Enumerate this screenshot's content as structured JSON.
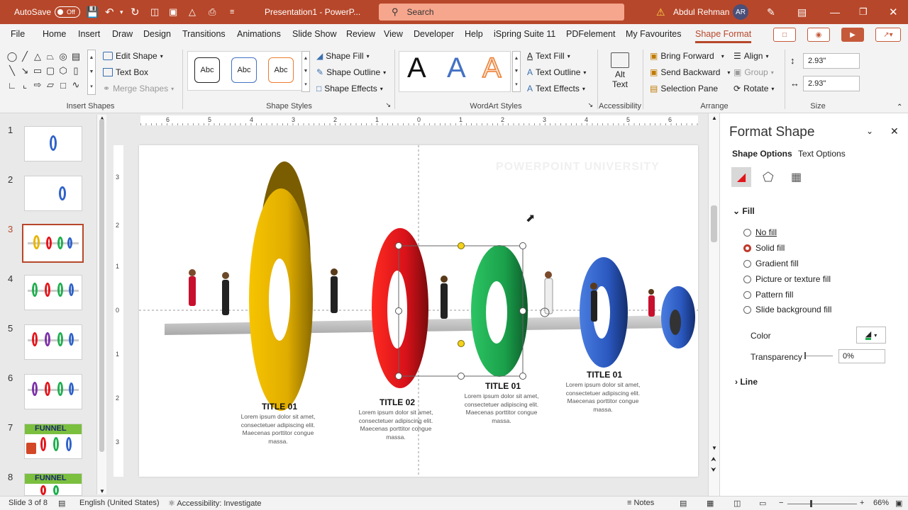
{
  "titlebar": {
    "autosave_label": "AutoSave",
    "autosave_state": "Off",
    "doc_title": "Presentation1 - PowerP...",
    "search_placeholder": "Search",
    "user_name": "Abdul Rehman",
    "user_initials": "AR",
    "accent": "#b7472a"
  },
  "menu": {
    "items": [
      "File",
      "Home",
      "Insert",
      "Draw",
      "Design",
      "Transitions",
      "Animations",
      "Slide Show",
      "Review",
      "View",
      "Developer",
      "Help",
      "iSpring Suite 11",
      "PDFelement",
      "My Favourites",
      "Shape Format"
    ],
    "active": "Shape Format"
  },
  "ribbon": {
    "insert_shapes": {
      "label": "Insert Shapes",
      "edit_shape": "Edit Shape",
      "text_box": "Text Box",
      "merge_shapes": "Merge Shapes"
    },
    "shape_styles": {
      "label": "Shape Styles",
      "abc": "Abc",
      "shape_fill": "Shape Fill",
      "shape_outline": "Shape Outline",
      "shape_effects": "Shape Effects"
    },
    "wordart": {
      "label": "WordArt Styles",
      "letter": "A",
      "text_fill": "Text Fill",
      "text_outline": "Text Outline",
      "text_effects": "Text Effects"
    },
    "accessibility": {
      "label": "Accessibility",
      "alt_text_1": "Alt",
      "alt_text_2": "Text"
    },
    "arrange": {
      "label": "Arrange",
      "bring_forward": "Bring Forward",
      "send_backward": "Send Backward",
      "selection_pane": "Selection Pane",
      "align": "Align",
      "group": "Group",
      "rotate": "Rotate"
    },
    "size": {
      "label": "Size",
      "height": "2.93\"",
      "width": "2.93\""
    }
  },
  "thumbnails": [
    "1",
    "2",
    "3",
    "4",
    "5",
    "6",
    "7",
    "8"
  ],
  "thumb_funnel_text": "FUNNEL",
  "active_slide": "3",
  "ruler": {
    "h_ticks": [
      "6",
      "5",
      "4",
      "3",
      "2",
      "1",
      "0",
      "1",
      "2",
      "3",
      "4",
      "5",
      "6"
    ],
    "v_ticks": [
      "3",
      "2",
      "1",
      "0",
      "1",
      "2",
      "3"
    ]
  },
  "slide": {
    "watermark": "POWERPOINT UNIVERSITY",
    "items": [
      {
        "title": "TITLE 01",
        "body": "Lorem ipsum dolor sit amet, consectetuer adipiscing elit. Maecenas porttitor congue massa."
      },
      {
        "title": "TITLE 02",
        "body": "Lorem ipsum dolor sit amet, consectetuer adipiscing elit. Maecenas porttitor congue massa."
      },
      {
        "title": "TITLE 01",
        "body": "Lorem ipsum dolor sit amet, consectetuer adipiscing elit. Maecenas porttitor congue massa."
      },
      {
        "title": "TITLE 01",
        "body": "Lorem ipsum dolor sit amet, consectetuer adipiscing elit. Maecenas porttitor congue massa."
      }
    ],
    "ring_colors": [
      "#e8b400",
      "#e3141b",
      "#1fae4f",
      "#2f62c9",
      "#2f62c9"
    ]
  },
  "format_pane": {
    "title": "Format Shape",
    "tab_shape": "Shape Options",
    "tab_text": "Text Options",
    "fill_section": "Fill",
    "fill_options": [
      "No fill",
      "Solid fill",
      "Gradient fill",
      "Picture or texture fill",
      "Pattern fill",
      "Slide background fill"
    ],
    "selected_fill": "Solid fill",
    "color_label": "Color",
    "transparency_label": "Transparency",
    "transparency_value": "0%",
    "line_section": "Line"
  },
  "status": {
    "slide_info": "Slide 3 of 8",
    "language": "English (United States)",
    "accessibility": "Accessibility: Investigate",
    "notes": "Notes",
    "zoom": "66%"
  }
}
